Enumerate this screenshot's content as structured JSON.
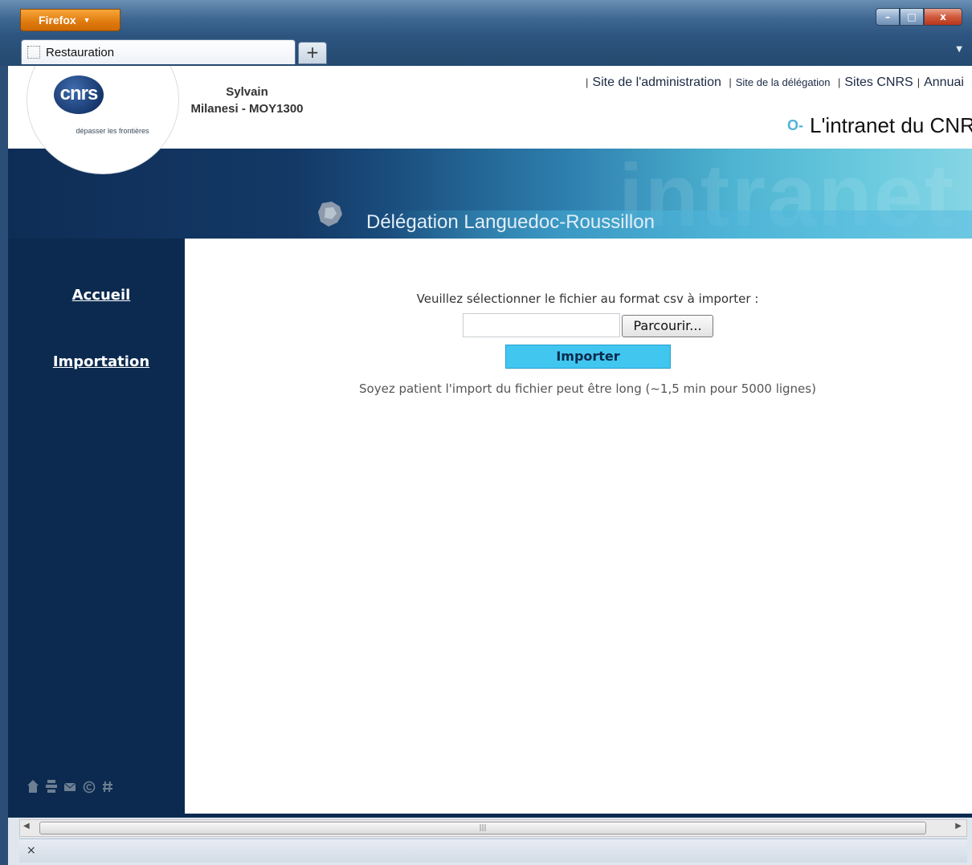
{
  "browser": {
    "menu_label": "Firefox",
    "menu_chevron": "▼",
    "tab_title": "Restauration",
    "new_tab": "+",
    "tablist": "▼",
    "minimize": "–",
    "maximize": "□",
    "close": "x"
  },
  "header": {
    "logo_text": "cnrs",
    "logo_tagline": "dépasser les frontières",
    "user_first": "Sylvain",
    "user_rest": "Milanesi - MOY1300",
    "sep": "|",
    "links": [
      "Site de l'administration",
      "Site de la délégation",
      "Sites CNRS",
      "Annuai"
    ],
    "key_icon": "O-",
    "intranet_title": "L'intranet du CNR",
    "watermark": "intranet",
    "delegation": "Délégation Languedoc-Roussillon"
  },
  "sidebar": {
    "items": [
      "Accueil",
      "Importation"
    ]
  },
  "main": {
    "prompt": "Veuillez sélectionner le fichier au format csv à importer :",
    "file_value": "",
    "browse_label": "Parcourir...",
    "import_label": "Importer",
    "notice": "Soyez patient l'import du fichier peut être long (~1,5 min pour 5000 lignes)"
  },
  "statusbar": {
    "scroll_grip": "|||",
    "close": "×"
  }
}
